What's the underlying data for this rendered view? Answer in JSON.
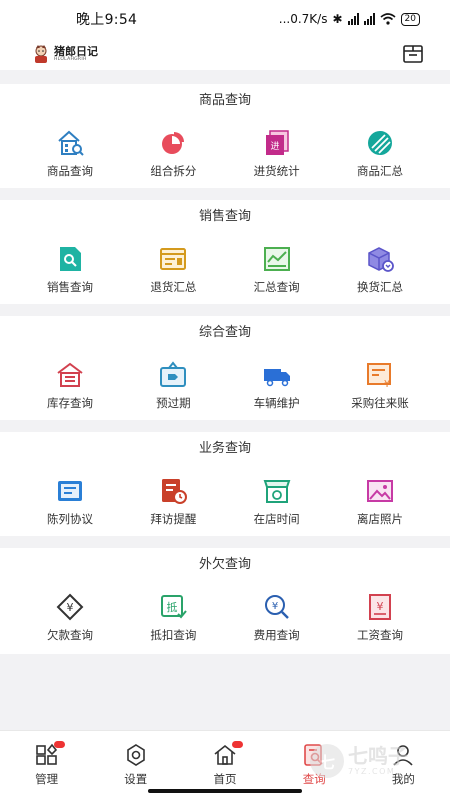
{
  "status_bar": {
    "time": "晚上9:54",
    "speed": "...0.7K/s",
    "battery": "20",
    "hd1": "HD",
    "hd2": "HD"
  },
  "header": {
    "logo_cn": "猪郎日记",
    "logo_en": "HLOLAHGRIH",
    "right_icon": "inbox-icon"
  },
  "sections": [
    {
      "title": "商品查询",
      "items": [
        {
          "label": "商品查询",
          "icon": "product-search-icon",
          "color": "#2f7fc1"
        },
        {
          "label": "组合拆分",
          "icon": "pie-chart-icon",
          "color": "#e84c5c"
        },
        {
          "label": "进货统计",
          "icon": "purchase-stats-icon",
          "color": "#c22b8a"
        },
        {
          "label": "商品汇总",
          "icon": "product-summary-icon",
          "color": "#14a79b"
        }
      ]
    },
    {
      "title": "销售查询",
      "items": [
        {
          "label": "销售查询",
          "icon": "sales-search-icon",
          "color": "#1fb3a3"
        },
        {
          "label": "退货汇总",
          "icon": "return-summary-icon",
          "color": "#d49a1d"
        },
        {
          "label": "汇总查询",
          "icon": "summary-chart-icon",
          "color": "#4caf50"
        },
        {
          "label": "换货汇总",
          "icon": "exchange-box-icon",
          "color": "#5b55c9"
        }
      ]
    },
    {
      "title": "综合查询",
      "items": [
        {
          "label": "库存查询",
          "icon": "warehouse-icon",
          "color": "#d2414f"
        },
        {
          "label": "预过期",
          "icon": "expiry-tag-icon",
          "color": "#2f8fbf"
        },
        {
          "label": "车辆维护",
          "icon": "truck-icon",
          "color": "#2a6fd6"
        },
        {
          "label": "采购往来账",
          "icon": "purchase-ledger-icon",
          "color": "#e87a2a"
        }
      ]
    },
    {
      "title": "业务查询",
      "items": [
        {
          "label": "陈列协议",
          "icon": "display-agreement-icon",
          "color": "#2a7fd6"
        },
        {
          "label": "拜访提醒",
          "icon": "visit-reminder-icon",
          "color": "#c9402a"
        },
        {
          "label": "在店时间",
          "icon": "store-time-icon",
          "color": "#1fa37a"
        },
        {
          "label": "离店照片",
          "icon": "photo-icon",
          "color": "#c73aa5"
        }
      ]
    },
    {
      "title": "外欠查询",
      "items": [
        {
          "label": "欠款查询",
          "icon": "debt-icon",
          "color": "#333333"
        },
        {
          "label": "抵扣查询",
          "icon": "deduction-icon",
          "color": "#2aa36a"
        },
        {
          "label": "费用查询",
          "icon": "expense-search-icon",
          "color": "#2a5fb0"
        },
        {
          "label": "工资查询",
          "icon": "salary-icon",
          "color": "#d2414f"
        }
      ]
    }
  ],
  "bottom_nav": [
    {
      "label": "管理",
      "icon": "manage-grid-icon",
      "badge": true
    },
    {
      "label": "设置",
      "icon": "settings-gear-icon",
      "badge": false
    },
    {
      "label": "首页",
      "icon": "home-icon",
      "badge": true
    },
    {
      "label": "查询",
      "icon": "query-icon",
      "badge": false,
      "active": true
    },
    {
      "label": "我的",
      "icon": "profile-icon",
      "badge": false
    }
  ],
  "watermark": {
    "cn": "七鸣子",
    "en": "7YZ.COM"
  }
}
